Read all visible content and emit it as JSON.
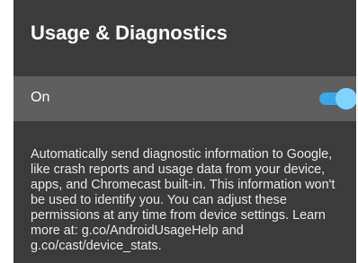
{
  "screen": {
    "title": "Usage & Diagnostics",
    "setting": {
      "label": "On",
      "toggle_state": "on"
    },
    "description": "Automatically send diagnostic information to Google, like crash reports and usage data from your device, apps, and Chromecast built-in. This information won't be used to identify you. You can adjust these permissions at any time from device settings. Learn more at: g.co/AndroidUsageHelp and g.co/cast/device_stats."
  },
  "colors": {
    "panel_background": "#3b3b3b",
    "selected_row": "#5f5f5f",
    "toggle_track": "#3aa7e8",
    "toggle_thumb": "#7fd4ff",
    "text_primary": "#ffffff"
  }
}
